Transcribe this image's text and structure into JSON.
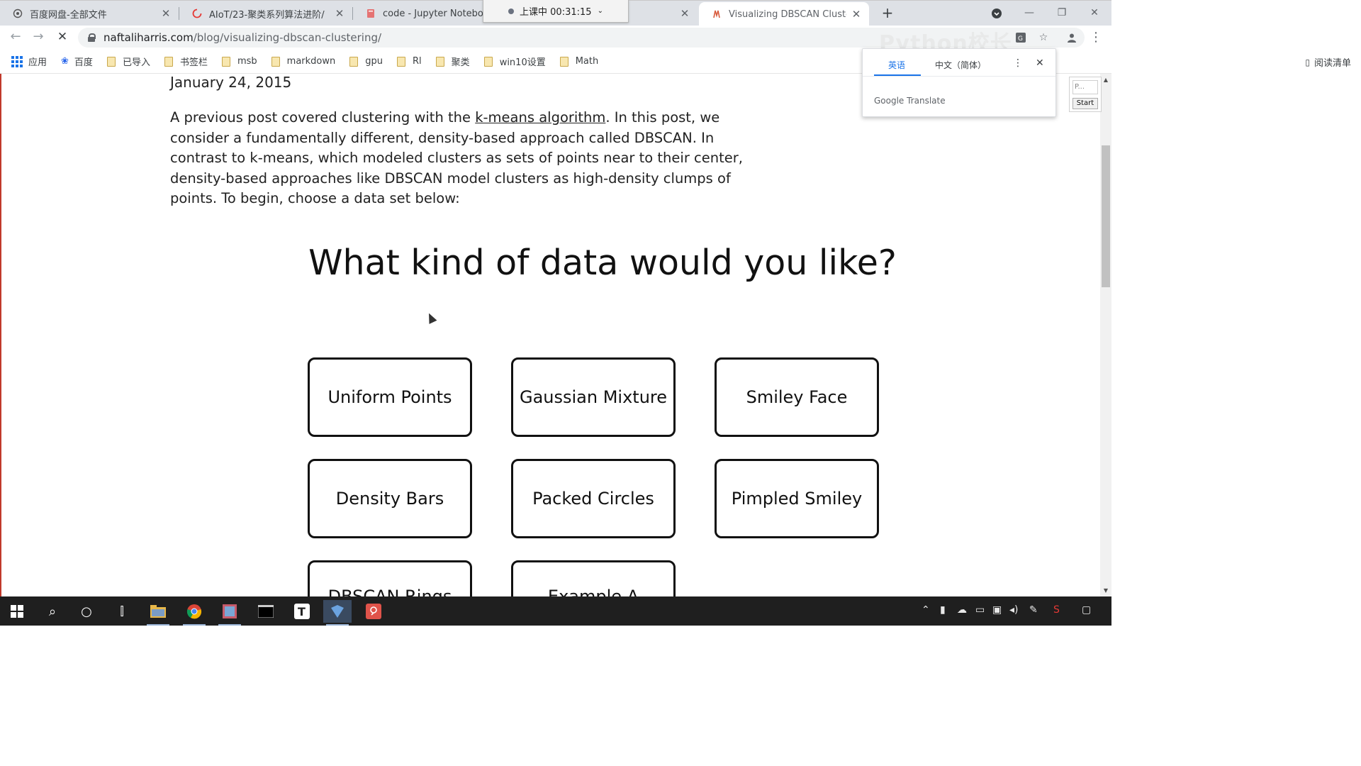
{
  "browser": {
    "tabs": [
      {
        "title": "百度网盘-全部文件",
        "icon": "cloud-icon"
      },
      {
        "title": "AIoT/23-聚类系列算法进阶/",
        "icon": "loading-spinner-icon"
      },
      {
        "title": "code - Jupyter Notebook",
        "icon": "notebook-icon"
      },
      {
        "title": "Visualizing DBSCAN Clustering",
        "icon": "site-favicon-icon",
        "active": true
      }
    ],
    "recording_label": "上课中 00:31:15",
    "url_host": "naftaliharris.com",
    "url_path": "/blog/visualizing-dbscan-clustering/",
    "watermark": "Python校长"
  },
  "bookmarks": {
    "apps_label": "应用",
    "items": [
      "百度",
      "已导入",
      "书签栏",
      "msb",
      "markdown",
      "gpu",
      "Rl",
      "聚类",
      "win10设置",
      "Math"
    ],
    "reading_list": "阅读清单"
  },
  "translate_popup": {
    "source_lang": "英语",
    "target_lang": "中文（简体）",
    "brand": "Google Translate"
  },
  "mini_widget": {
    "input_placeholder": "P...",
    "start_label": "Start"
  },
  "post": {
    "date": "January 24, 2015",
    "intro_before_link": "A previous post covered clustering with the ",
    "link_text": "k-means algorithm",
    "intro_after_link": ". In this post, we consider a fundamentally different, density-based approach called DBSCAN. In contrast to k-means, which modeled clusters as sets of points near to their center, density-based approaches like DBSCAN model clusters as high-density clumps of points. To begin, choose a data set below:",
    "heading": "What kind of data would you like?",
    "datasets": [
      "Uniform Points",
      "Gaussian Mixture",
      "Smiley Face",
      "Density Bars",
      "Packed Circles",
      "Pimpled Smiley",
      "DBSCAN Rings",
      "Example A"
    ]
  }
}
